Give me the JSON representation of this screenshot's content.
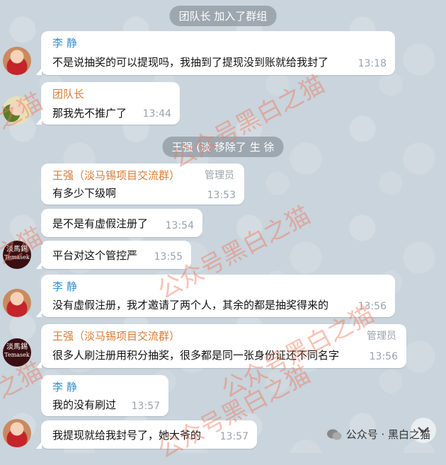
{
  "system_events": [
    {
      "text": "团队长 加入了群组"
    },
    {
      "text": "王强 (淡 移除了 生 徐"
    }
  ],
  "messages": [
    {
      "sender": "李 静",
      "text": "不是说抽奖的可以提现吗，我抽到了提现没到账就给我封了",
      "time": "13:18"
    },
    {
      "sender": "团队长",
      "text": "那我先不推广了",
      "time": "13:44"
    },
    {
      "sender": "王强（淡马锡项目交流群）",
      "role": "管理员",
      "text": "有多少下级啊",
      "time": "13:53"
    },
    {
      "text": "是不是有虚假注册了",
      "time": "13:54"
    },
    {
      "text": "平台对这个管控严",
      "time": "13:55"
    },
    {
      "sender": "李 静",
      "text": "没有虚假注册，我才邀请了两个人，其余的都是抽奖得来的",
      "time": "13:56"
    },
    {
      "sender": "王强（淡马锡项目交流群）",
      "role": "管理员",
      "text": "很多人刷注册用积分抽奖，很多都是同一张身份证还不同名字",
      "time": "13:56"
    },
    {
      "sender": "李 静",
      "text": "我的没有刷过",
      "time": "13:57"
    },
    {
      "text": "我提现就给我封号了，她大爷的",
      "time": "13:57"
    }
  ],
  "avatars": {
    "temasek_line1": "淡馬錫",
    "temasek_line2": "Temasek"
  },
  "watermarks": [
    "公众号黑白之猫",
    "公众号黑白之猫",
    "公众号黑白之猫",
    "公众号黑白之猫",
    "之猫",
    "之猫",
    "之猫"
  ],
  "footer": {
    "text": "公众号 · 黑白之猫",
    "icon": "wechat-icon"
  },
  "scroll_button": {
    "icon": "chevron-down-icon"
  }
}
